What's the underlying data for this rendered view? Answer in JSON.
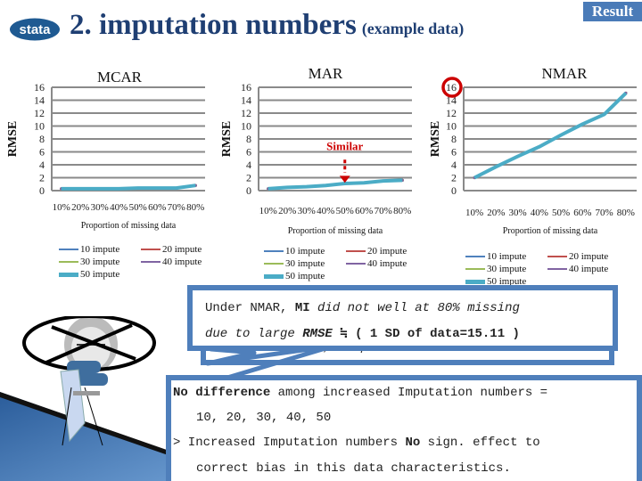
{
  "header": {
    "title": "2. imputation numbers",
    "subtitle": "(example data)",
    "badge": "Result",
    "logo_text": "stata"
  },
  "colors": {
    "title": "#1f3f73",
    "badge": "#4a7bb8",
    "box_border": "#4f7fbb",
    "line_main": "#4bacc6",
    "highlight_red": "#cc0000"
  },
  "chart_data": [
    {
      "type": "line",
      "title": "MCAR",
      "xlabel": "Proportion of missing data",
      "ylabel": "RMSE",
      "categories": [
        "10%",
        "20%",
        "30%",
        "40%",
        "50%",
        "60%",
        "70%",
        "80%"
      ],
      "ylim": [
        0,
        16
      ],
      "yticks": [
        0,
        2,
        4,
        6,
        8,
        10,
        12,
        14,
        16
      ],
      "grid": true,
      "series": [
        {
          "name": "10 impute",
          "color": "#4f81bd",
          "values": [
            0.3,
            0.3,
            0.3,
            0.3,
            0.4,
            0.4,
            0.4,
            0.8
          ]
        },
        {
          "name": "20 impute",
          "color": "#c0504d",
          "values": [
            0.3,
            0.3,
            0.3,
            0.3,
            0.4,
            0.4,
            0.4,
            0.8
          ]
        },
        {
          "name": "30 impute",
          "color": "#9bbb59",
          "values": [
            0.3,
            0.3,
            0.3,
            0.3,
            0.4,
            0.4,
            0.4,
            0.8
          ]
        },
        {
          "name": "40 impute",
          "color": "#8064a2",
          "values": [
            0.3,
            0.3,
            0.3,
            0.3,
            0.4,
            0.4,
            0.4,
            0.8
          ]
        },
        {
          "name": "50 impute",
          "color": "#4bacc6",
          "values": [
            0.3,
            0.3,
            0.3,
            0.3,
            0.4,
            0.4,
            0.4,
            0.8
          ]
        }
      ],
      "legend": "bottom"
    },
    {
      "type": "line",
      "title": "MAR",
      "xlabel": "Proportion of missing data",
      "ylabel": "RMSE",
      "categories": [
        "10%",
        "20%",
        "30%",
        "40%",
        "50%",
        "60%",
        "70%",
        "80%"
      ],
      "ylim": [
        0,
        16
      ],
      "yticks": [
        0,
        2,
        4,
        6,
        8,
        10,
        12,
        14,
        16
      ],
      "grid": true,
      "annotation": {
        "text": "Similar",
        "at_category": "50%"
      },
      "series": [
        {
          "name": "10 impute",
          "color": "#4f81bd",
          "values": [
            0.3,
            0.5,
            0.6,
            0.8,
            1.1,
            1.2,
            1.5,
            1.6
          ]
        },
        {
          "name": "20 impute",
          "color": "#c0504d",
          "values": [
            0.3,
            0.5,
            0.6,
            0.8,
            1.1,
            1.2,
            1.5,
            1.6
          ]
        },
        {
          "name": "30 impute",
          "color": "#9bbb59",
          "values": [
            0.3,
            0.5,
            0.6,
            0.8,
            1.1,
            1.2,
            1.5,
            1.6
          ]
        },
        {
          "name": "40 impute",
          "color": "#8064a2",
          "values": [
            0.3,
            0.5,
            0.6,
            0.8,
            1.1,
            1.2,
            1.5,
            1.6
          ]
        },
        {
          "name": "50 impute",
          "color": "#4bacc6",
          "values": [
            0.3,
            0.5,
            0.6,
            0.8,
            1.1,
            1.2,
            1.5,
            1.6
          ]
        }
      ],
      "legend": "bottom"
    },
    {
      "type": "line",
      "title": "NMAR",
      "xlabel": "Proportion of missing data",
      "ylabel": "RMSE",
      "categories": [
        "10%",
        "20%",
        "30%",
        "40%",
        "50%",
        "60%",
        "70%",
        "80%"
      ],
      "ylim": [
        0,
        16
      ],
      "yticks": [
        0,
        2,
        4,
        6,
        8,
        10,
        12,
        14,
        16
      ],
      "grid": true,
      "highlighted_tick": "16",
      "series": [
        {
          "name": "10 impute",
          "color": "#4f81bd",
          "values": [
            2.0,
            3.7,
            5.3,
            6.8,
            8.6,
            10.3,
            11.8,
            15.1
          ]
        },
        {
          "name": "20 impute",
          "color": "#c0504d",
          "values": [
            2.0,
            3.7,
            5.3,
            6.8,
            8.6,
            10.3,
            11.8,
            15.1
          ]
        },
        {
          "name": "30 impute",
          "color": "#9bbb59",
          "values": [
            2.0,
            3.7,
            5.3,
            6.8,
            8.6,
            10.3,
            11.8,
            15.1
          ]
        },
        {
          "name": "40 impute",
          "color": "#8064a2",
          "values": [
            2.0,
            3.7,
            5.3,
            6.8,
            8.6,
            10.3,
            11.8,
            15.1
          ]
        },
        {
          "name": "50 impute",
          "color": "#4bacc6",
          "values": [
            2.0,
            3.7,
            5.3,
            6.8,
            8.6,
            10.3,
            11.8,
            15.1
          ]
        }
      ],
      "legend": "bottom"
    }
  ],
  "callouts": {
    "hidden_line": "Under MAR/MCAR, MI produces unbiased est.",
    "nmar": {
      "l1_a": "Under NMAR, ",
      "l1_b": "MI",
      "l1_c": " did not well at 80% missing",
      "l2_a": "due to large ",
      "l2_b": "RMSE",
      "l2_c": " ≒ ",
      "l2_d": "( 1 SD of data=15.11 )"
    },
    "bottom": {
      "l1_a": "No difference",
      "l1_b": " among increased Imputation numbers  =",
      "l2": "10, 20, 30, 40, 50",
      "l3_a": "> Increased Imputation numbers ",
      "l3_b": "No",
      "l3_c": " sign. effect to",
      "l4": "correct bias in this data characteristics."
    }
  }
}
